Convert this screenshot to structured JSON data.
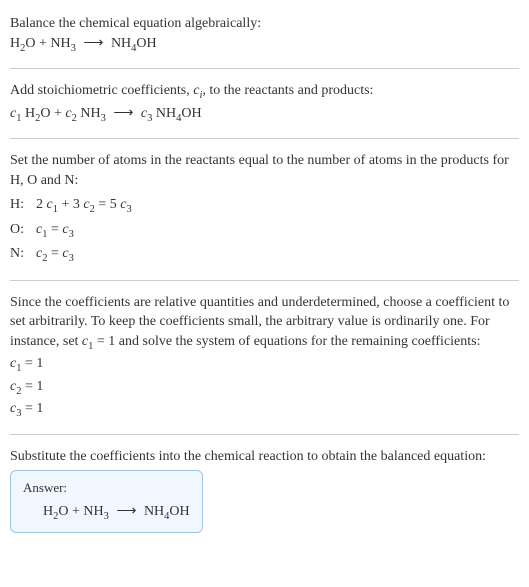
{
  "section1": {
    "title": "Balance the chemical equation algebraically:",
    "equation_html": "H<sub>2</sub>O + NH<sub>3</sub> <span class='arrow'>⟶</span> NH<sub>4</sub>OH"
  },
  "section2": {
    "text_html": "Add stoichiometric coefficients, <span class='ital'>c</span><span class='sub-i'>i</span>, to the reactants and products:",
    "equation_html": "<span class='ital'>c</span><sub>1</sub> H<sub>2</sub>O + <span class='ital'>c</span><sub>2</sub> NH<sub>3</sub> <span class='arrow'>⟶</span> <span class='ital'>c</span><sub>3</sub> NH<sub>4</sub>OH"
  },
  "section3": {
    "text": "Set the number of atoms in the reactants equal to the number of atoms in the products for H, O and N:",
    "rows": [
      {
        "label": "H:",
        "eq_html": "2 <span class='ital'>c</span><sub>1</sub> + 3 <span class='ital'>c</span><sub>2</sub> = 5 <span class='ital'>c</span><sub>3</sub>"
      },
      {
        "label": "O:",
        "eq_html": "<span class='ital'>c</span><sub>1</sub> = <span class='ital'>c</span><sub>3</sub>"
      },
      {
        "label": "N:",
        "eq_html": "<span class='ital'>c</span><sub>2</sub> = <span class='ital'>c</span><sub>3</sub>"
      }
    ]
  },
  "section4": {
    "text_html": "Since the coefficients are relative quantities and underdetermined, choose a coefficient to set arbitrarily. To keep the coefficients small, the arbitrary value is ordinarily one. For instance, set <span class='ital'>c</span><sub>1</sub> = 1 and solve the system of equations for the remaining coefficients:",
    "results": [
      "<span class='ital'>c</span><sub>1</sub> = 1",
      "<span class='ital'>c</span><sub>2</sub> = 1",
      "<span class='ital'>c</span><sub>3</sub> = 1"
    ]
  },
  "section5": {
    "text": "Substitute the coefficients into the chemical reaction to obtain the balanced equation:"
  },
  "answer": {
    "label": "Answer:",
    "equation_html": "H<sub>2</sub>O + NH<sub>3</sub> <span class='arrow'>⟶</span> NH<sub>4</sub>OH"
  }
}
